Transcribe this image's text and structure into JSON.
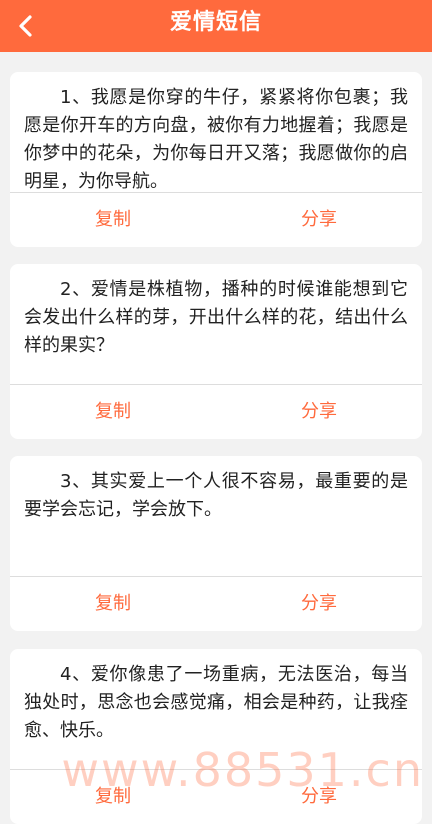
{
  "header": {
    "title": "爱情短信",
    "back_icon": "chevron-left-icon",
    "bg_color": "#ff6a3d"
  },
  "messages": [
    {
      "text": "1、我愿是你穿的牛仔，紧紧将你包裹；我愿是你开车的方向盘，被你有力地握着；我愿是你梦中的花朵，为你每日开又落；我愿做你的启明星，为你导航。",
      "copy_label": "复制",
      "share_label": "分享"
    },
    {
      "text": "2、爱情是株植物，播种的时候谁能想到它会发出什么样的芽，开出什么样的花，结出什么样的果实？",
      "copy_label": "复制",
      "share_label": "分享"
    },
    {
      "text": "3、其实爱上一个人很不容易，最重要的是要学会忘记，学会放下。",
      "copy_label": "复制",
      "share_label": "分享"
    },
    {
      "text": "4、爱你像患了一场重病，无法医治，每当独处时，思念也会感觉痛，相会是种药，让我痊愈、快乐。",
      "copy_label": "复制",
      "share_label": "分享"
    }
  ],
  "watermark": "www.88531.cn",
  "accent_color": "#ff6a3d"
}
